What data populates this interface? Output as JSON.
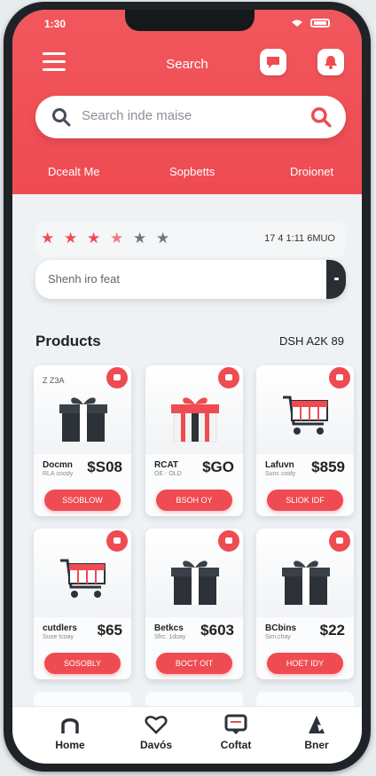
{
  "status": {
    "time": "1:30"
  },
  "header": {
    "title": "Search",
    "menu_icon": "hamburger-icon",
    "action_icons": [
      "chat-icon",
      "bell-icon"
    ],
    "brand_color": "#ef4b52"
  },
  "search": {
    "placeholder": "Search inde maise"
  },
  "tabs": [
    "Dcealt Me",
    "Sopbetts",
    "Droionet"
  ],
  "rating": {
    "stars_filled": 4,
    "stars_total": 6,
    "text": "17 4 1:11 6MUO"
  },
  "secondary_input": {
    "placeholder": "Shenh iro feat"
  },
  "products_section": {
    "title": "Products",
    "meta": "DSH A2K 89"
  },
  "products": [
    {
      "tiny": "Z Z3A",
      "name": "Docmn",
      "sub": "RLA coody",
      "price": "$S08",
      "cta": "SSOBLOW",
      "image": "gift-dark"
    },
    {
      "tiny": "",
      "name": "RCAT",
      "sub": "OE - OLD",
      "price": "$GO",
      "cta": "BSOH OY",
      "image": "gift-red"
    },
    {
      "tiny": "",
      "name": "Lafuvn",
      "sub": "Sunc coidy",
      "price": "$859",
      "cta": "SLIOK IDF",
      "image": "cart"
    },
    {
      "tiny": "",
      "name": "cutdlers",
      "sub": "Suoe tcoay",
      "price": "$65",
      "cta": "SOSOBLY",
      "image": "cart"
    },
    {
      "tiny": "",
      "name": "Betkcs",
      "sub": "Sfrc. 1doay",
      "price": "$603",
      "cta": "BOCT OIT",
      "image": "gift-dark"
    },
    {
      "tiny": "",
      "name": "BCbins",
      "sub": "Sim.chay",
      "price": "$22",
      "cta": "HOET IDY",
      "image": "gift-dark"
    }
  ],
  "tabbar": [
    {
      "label": "Home",
      "icon": "home-icon"
    },
    {
      "label": "Davós",
      "icon": "heart-icon"
    },
    {
      "label": "Coftat",
      "icon": "chat-icon"
    },
    {
      "label": "Bner",
      "icon": "profile-icon"
    }
  ]
}
